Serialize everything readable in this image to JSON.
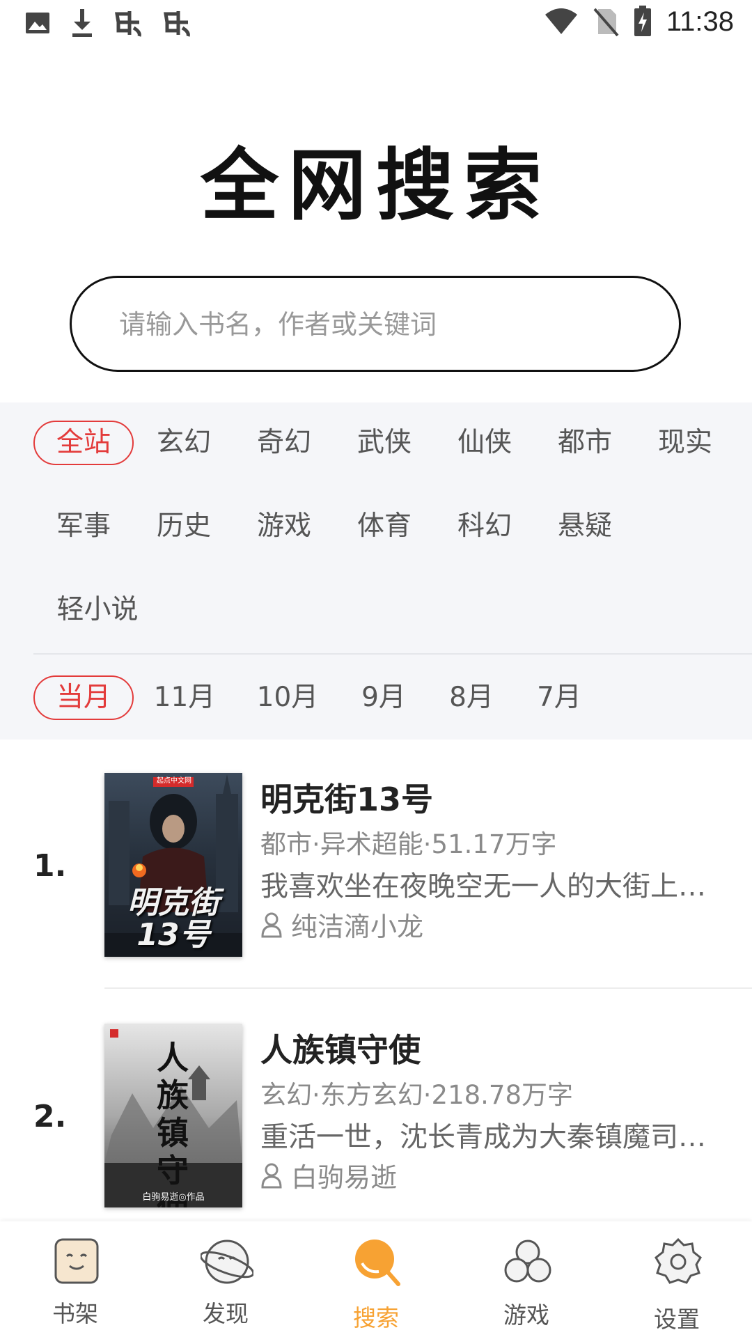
{
  "status_bar": {
    "time": "11:38",
    "left_icons": [
      "image-icon",
      "download-icon",
      "bug-icon",
      "bug-icon"
    ],
    "right_icons": [
      "wifi-icon",
      "no-sim-icon",
      "battery-charging-icon"
    ]
  },
  "header": {
    "title": "全网搜索"
  },
  "search": {
    "placeholder": "请输入书名，作者或关键词",
    "value": ""
  },
  "filters": {
    "categories": [
      "全站",
      "玄幻",
      "奇幻",
      "武侠",
      "仙侠",
      "都市",
      "现实",
      "军事",
      "历史",
      "游戏",
      "体育",
      "科幻",
      "悬疑",
      "轻小说"
    ],
    "selected_category": "全站",
    "months": [
      "当月",
      "11月",
      "10月",
      "9月",
      "8月",
      "7月"
    ],
    "selected_month": "当月"
  },
  "books": [
    {
      "rank": "1.",
      "title": "明克街13号",
      "meta": "都市·异术超能·51.17万字",
      "desc": "我喜欢坐在夜晚空无一人的大街上…",
      "author": "纯洁滴小龙",
      "cover_title": "明克街13号",
      "cover_badge": "起点中文网"
    },
    {
      "rank": "2.",
      "title": "人族镇守使",
      "meta": "玄幻·东方玄幻·218.78万字",
      "desc": "重活一世，沈长青成为大秦镇魔司…",
      "author": "白驹易逝",
      "cover_title": "人族镇守使",
      "cover_byline": "白驹易逝◎作品"
    }
  ],
  "bottom_nav": [
    {
      "label": "书架",
      "icon": "bookshelf-icon",
      "active": false
    },
    {
      "label": "发现",
      "icon": "discover-icon",
      "active": false
    },
    {
      "label": "搜索",
      "icon": "search-icon",
      "active": true
    },
    {
      "label": "游戏",
      "icon": "game-icon",
      "active": false
    },
    {
      "label": "设置",
      "icon": "settings-icon",
      "active": false
    }
  ],
  "colors": {
    "accent_red": "#e33b3b",
    "accent_orange": "#f7a233",
    "panel_bg": "#f5f6f9"
  }
}
